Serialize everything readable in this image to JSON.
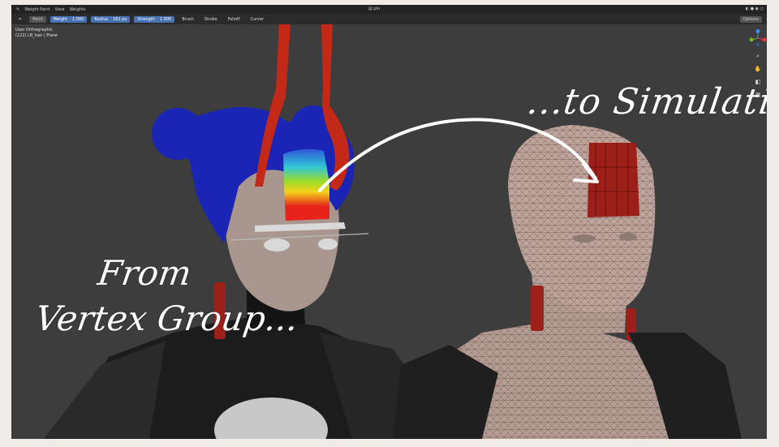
{
  "topbar": {
    "mode": "Weight Paint",
    "menu_view": "View",
    "menu_weights": "Weights",
    "scene_name": "pin",
    "right_text": "Options"
  },
  "toolbar": {
    "brush_name": "Paint",
    "weight_label": "Weight",
    "weight_value": "1.000",
    "radius_label": "Radius",
    "radius_value": "161 px",
    "strength_label": "Strength",
    "strength_value": "1.000",
    "menu_brush": "Brush",
    "menu_stroke": "Stroke",
    "menu_falloff": "Falloff",
    "menu_cursor": "Cursor",
    "options": "Options"
  },
  "viewport": {
    "view_name": "User Orthographic",
    "object_name": "(122) LB_hair | Plane"
  },
  "captions": {
    "right": "...to Simulation",
    "left_line1": "From",
    "left_line2": "Vertex Group..."
  },
  "colors": {
    "viewport_bg": "#3d3d3d",
    "weight_red": "#e8231c",
    "hair_blue": "#1a25b5",
    "pin_red": "#9d1f1a",
    "accent": "#4772b3"
  }
}
